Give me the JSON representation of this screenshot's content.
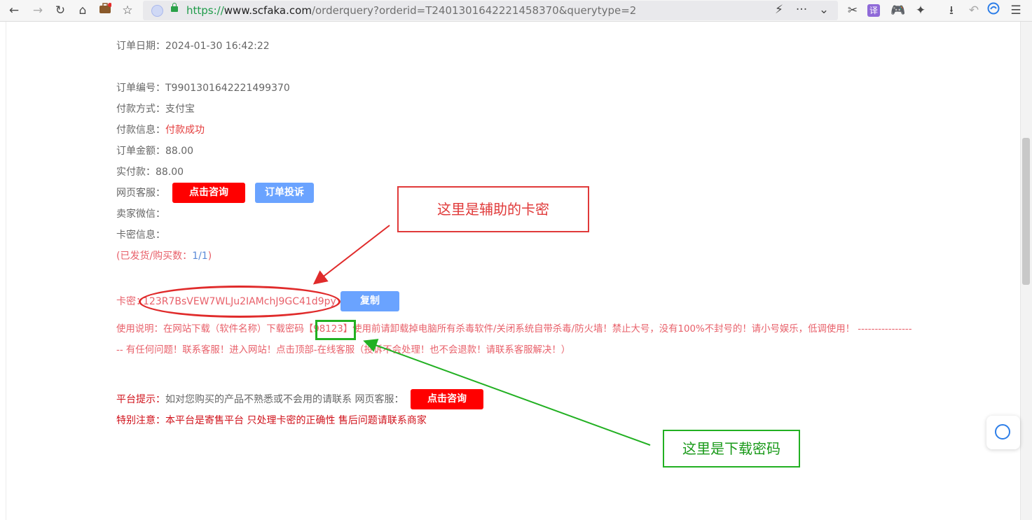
{
  "browser": {
    "url_protocol": "https://",
    "url_host": "www.scfaka.com",
    "url_path": "/orderquery?orderid=T2401301642221458370&querytype=2",
    "nav_icons": {
      "back": "←",
      "forward": "→",
      "reload": "↻",
      "home": "⌂",
      "bookmark": "☆"
    },
    "extension_icons": {
      "lightning": "⚡",
      "more": "···",
      "dropdown": "⌄",
      "scissors": "✂",
      "translate": "译",
      "game": "🎮",
      "puzzle": "✦",
      "download": "⭳",
      "undo": "↶",
      "menu": "☰"
    }
  },
  "order": {
    "date_label": "订单日期：",
    "date_value": "2024-01-30 16:42:22",
    "number_label": "订单编号：",
    "number_value": "T9901301642221499370",
    "pay_method_label": "付款方式：",
    "pay_method_value": "支付宝",
    "pay_info_label": "付款信息：",
    "pay_info_value": "付款成功",
    "amount_label": "订单金额：",
    "amount_value": "88.00",
    "paid_label": "实付款：",
    "paid_value": "88.00",
    "service_label": "网页客服：",
    "consult_button": "点击咨询",
    "complaint_button": "订单投诉",
    "seller_wechat_label": "卖家微信：",
    "card_info_label": "卡密信息：",
    "shipped_prefix": "(已发货/购买数：",
    "shipped_value": "1/1",
    "shipped_suffix": ")"
  },
  "card": {
    "label": "卡密：",
    "value": "123R7BsVEW7WLJu2IAMchJ9GC41d9py",
    "copy_button": "复制"
  },
  "instructions": {
    "line1": "使用说明：在网站下载（软件名称）下载密码【98123】使用前请卸载掉电脑所有杀毒软件/关闭系统自带杀毒/防火墙！禁止大号，没有100%不封号的！请小号娱乐，低调使用！ ----------------",
    "line2": "-- 有任何问题！联系客服！进入网站！点击顶部-在线客服（投诉不会处理！也不会退款！请联系客服解决！）"
  },
  "platform": {
    "tip_label": "平台提示：",
    "tip_text": "如对您购买的产品不熟悉或不会用的请联系 网页客服：",
    "consult_button": "点击咨询",
    "notice": "特别注意：本平台是寄售平台 只处理卡密的正确性 售后问题请联系商家"
  },
  "annotations": {
    "red_label": "这里是辅助的卡密",
    "green_label": "这里是下载密码",
    "red_color": "#e03a3a",
    "green_color": "#22b022"
  }
}
